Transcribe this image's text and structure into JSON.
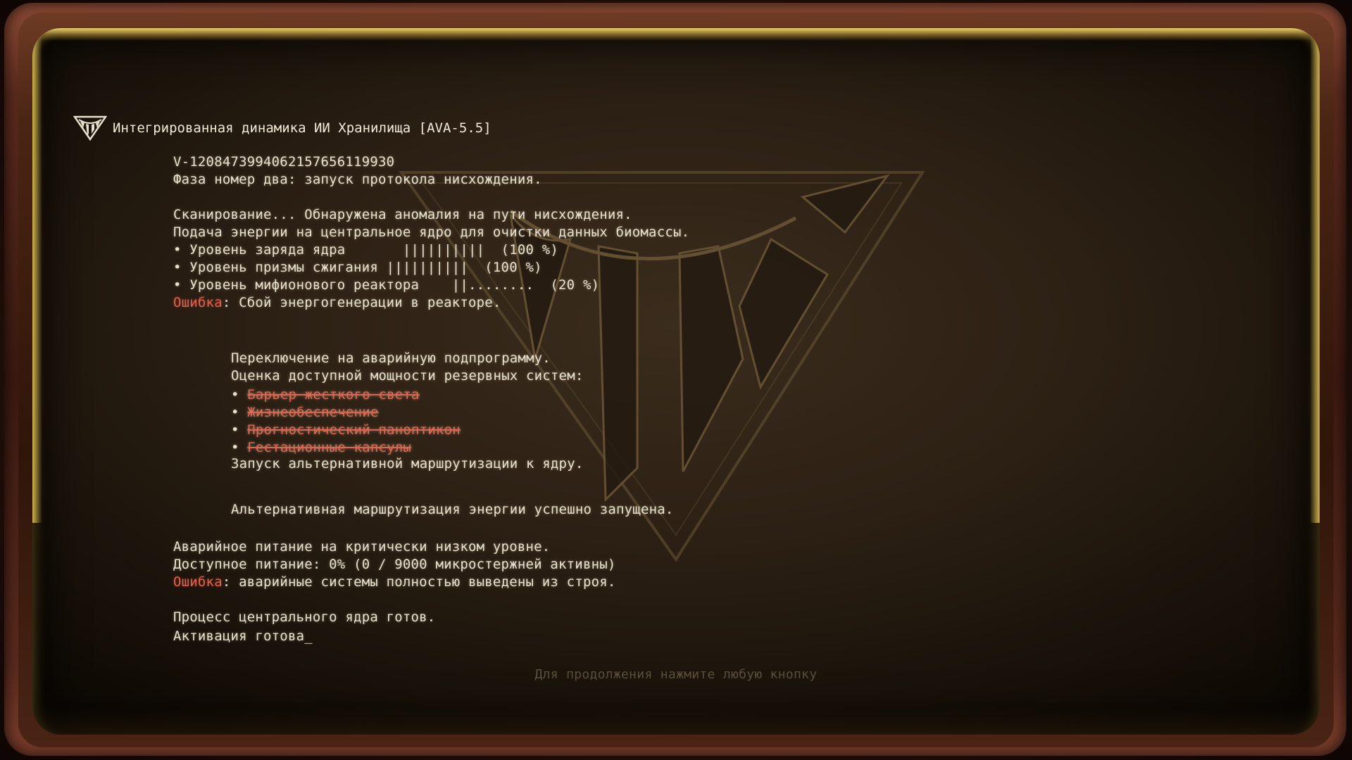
{
  "header": {
    "title": "Интегрированная динамика ИИ Хранилища [AVA-5.5]"
  },
  "log": {
    "id_line": "V-1208473994062157656119930",
    "phase_line": "Фаза номер два: запуск протокола нисхождения.",
    "scan_line": "Сканирование... Обнаружена аномалия на пути нисхождения.",
    "power_line": "Подача энергии на центральное ядро для очистки данных биомассы.",
    "meters": [
      {
        "label": "• Уровень заряда ядра       ||||||||||  (100 %)",
        "value": 100
      },
      {
        "label": "• Уровень призмы сжигания ||||||||||  (100 %)",
        "value": 100
      },
      {
        "label": "• Уровень мифионового реактора    ||........  (20 %)",
        "value": 20
      }
    ],
    "error1_tag": "Ошибка",
    "error1_text": ": Сбой энергогенерации в реакторе.",
    "switch_line": "Переключение на аварийную подпрограмму.",
    "assess_line": "Оценка доступной мощности резервных систем:",
    "systems": [
      "Барьер жесткого света",
      "Жизнеобеспечение",
      "Прогностический паноптикон",
      "Гестационные капсулы"
    ],
    "reroute_line": "Запуск альтернативной маршрутизации к ядру.",
    "reroute_ok_line": "Альтернативная маршрутизация энергии успешно запущена.",
    "emergency_line": "Аварийное питание на критически низком уровне.",
    "available_line": "Доступное питание: 0% (0 / 9000 микростержней активны)",
    "error2_tag": "Ошибка",
    "error2_text": ": аварийные системы полностью выведены из строя.",
    "core_ready_line": "Процесс центрального ядра готов.",
    "activation_line": "Активация готова_"
  },
  "footer": {
    "hint": "Для продолжения нажмите любую кнопку"
  },
  "colors": {
    "text": "#e8e1cf",
    "error": "#e2604e",
    "glow": "#d6b048",
    "bezel": "#5a2a1d"
  },
  "icons": {
    "logo": "vault-triangle-emblem-icon"
  }
}
